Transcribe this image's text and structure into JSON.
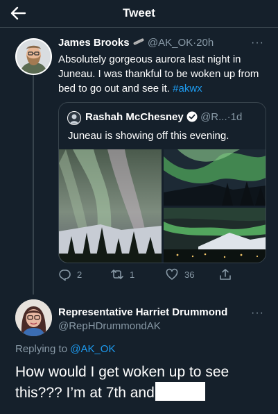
{
  "header": {
    "title": "Tweet"
  },
  "tweet1": {
    "name": "James Brooks",
    "emoji_icon": "nail-file-icon",
    "handle": "@AK_OK",
    "separator": "·",
    "time": "20h",
    "more_label": "···",
    "text": "Absolutely gorgeous aurora last night in Juneau. I was thankful to be woken up from bed to go out and see it.",
    "hashtag": "#akwx"
  },
  "quote": {
    "name": "Rashah McChesney",
    "handle": "@R...",
    "separator": "·",
    "time": "1d",
    "text": "Juneau is showing off this evening."
  },
  "actions": {
    "replies": "2",
    "retweets": "1",
    "likes": "36"
  },
  "tweet2": {
    "name": "Representative Harriet Drummond",
    "handle": "@RepHDrummondAK",
    "more_label": "···",
    "replying_prefix": "Replying to",
    "replying_to": "@AK_OK",
    "text": "How would I get woken up to see this??? I’m at 7th and"
  },
  "colors": {
    "background": "#15202b",
    "accent": "#1d9bf0",
    "muted": "#8899a6",
    "border": "#38444d",
    "aurora_green": "#6fd37a"
  }
}
